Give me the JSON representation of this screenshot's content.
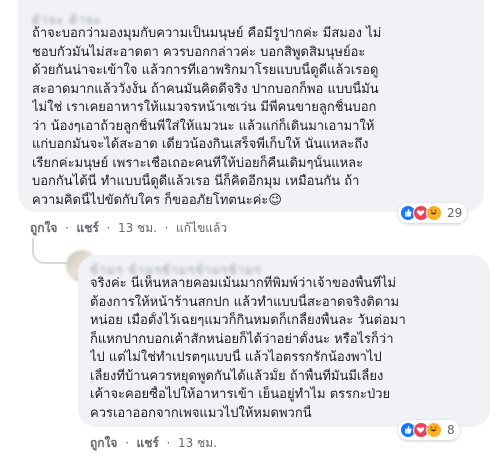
{
  "comment1": {
    "author": "ด้าจะ ด้าจะ",
    "lines": [
      "ถ้าจะบอกว่ามองมุมกับความเป็นมนุษย์ คือมีรูปากค่ะ มีสมอง ไม่",
      "ชอบกัวมันไม่สะอาดตา ควรบอกกล่าวค่ะ บอกสิพูดสิมนุษย์อะ",
      "ด้วยกันน่าจะเข้าใจ แล้วการที่เอาพริกมาโรยแบบนี้ดูดีแล้วเรอดู",
      "สะอาดมากแล้ววั่งงั้น ถ้าคนมันคิดดีจริง ปากบอกก็พอ แบบนี้มัน",
      "ไม่ใช่ เราเคยอาหารให้แมวจรหน้าเซเว่น มีพี่คนขายลูกชิ้นบอก",
      "ว่า น้องๆเอาถ้วยลูกชิ้นพี่ใส่ให้แมวนะ แล้วแก่ก็เดินมาเอามาให้",
      "แก่บอกมันจะได้สะอาด เดี๋ยวน้องกินเสร็จพี่เก็บให้ นั่นแหละถึง",
      "เรียกค่ะมนุษย์ เพราะเชื่อเถอะคนที่ให้บ่อยก็คืนเดิมๆนั้นแหละ",
      "บอกกันได้นี่ ทำแบบนี้ดูดีแล้วเรอ นี่ก็คิดอีกมุม เหมือนกัน ถ้า",
      "ความคิดนี้ไปขัดกับใคร ก็ขออภัยโทตนะค่ะ😉"
    ],
    "actions": {
      "like": "ถูกใจ",
      "reply": "แชร์",
      "time": "13 ชม.",
      "edited": "แก้ไขแล้ว"
    },
    "reaction_count": "29"
  },
  "comment2": {
    "author": "ข้ามๆ ข้ามๆข้ามๆข้ามๆข้ามๆ",
    "lines": [
      "จริงค่ะ นี่เห็นหลายคอมเม้นมากที่พิมพ์ว่าเจ้าของพื้นที่ไม่",
      "ต้องการให้หน้าร้านสกปก แล้วทำแบบนี้สะอาดจริงติดาม",
      "หน่อย เมื่อตั้งไว้เฉยๆแมวก็กินหมดก็เกลี้ยงพื้นละ วันต่อมา",
      "ก็แหกปากบอกเค้าสักหน่อยก็ได้ว่าอย่าตั้งนะ หรือไรก็ว่า",
      "ไป แต่ไม่ใช่ทำเปรตๆแบบนี้ แล้วไอตรรกรักน้องพาไป",
      "เลี้ยงที่บ้านควรหยุดพูดกันได้แล้วมั้ย ถ้าพื้นที่มันมีเลี้ยง",
      "เค้าจะคอยซื้อไปให้อาหารเข้า เย็นอยู่ทำไม ตรรกะป่วย",
      "ควรเอาออกจากเพจแมวไปให้หมดพวกนี้"
    ],
    "actions": {
      "like": "ถูกใจ",
      "reply": "แชร์",
      "time": "13 ชม."
    },
    "reaction_count": "8"
  },
  "colors": {
    "bubble": "#f0f2f5",
    "like_blue": "#1877f2",
    "love_red": "#f33e58",
    "haha_yellow": "#f7b125"
  },
  "icons": [
    "like-icon",
    "love-icon",
    "haha-icon"
  ]
}
